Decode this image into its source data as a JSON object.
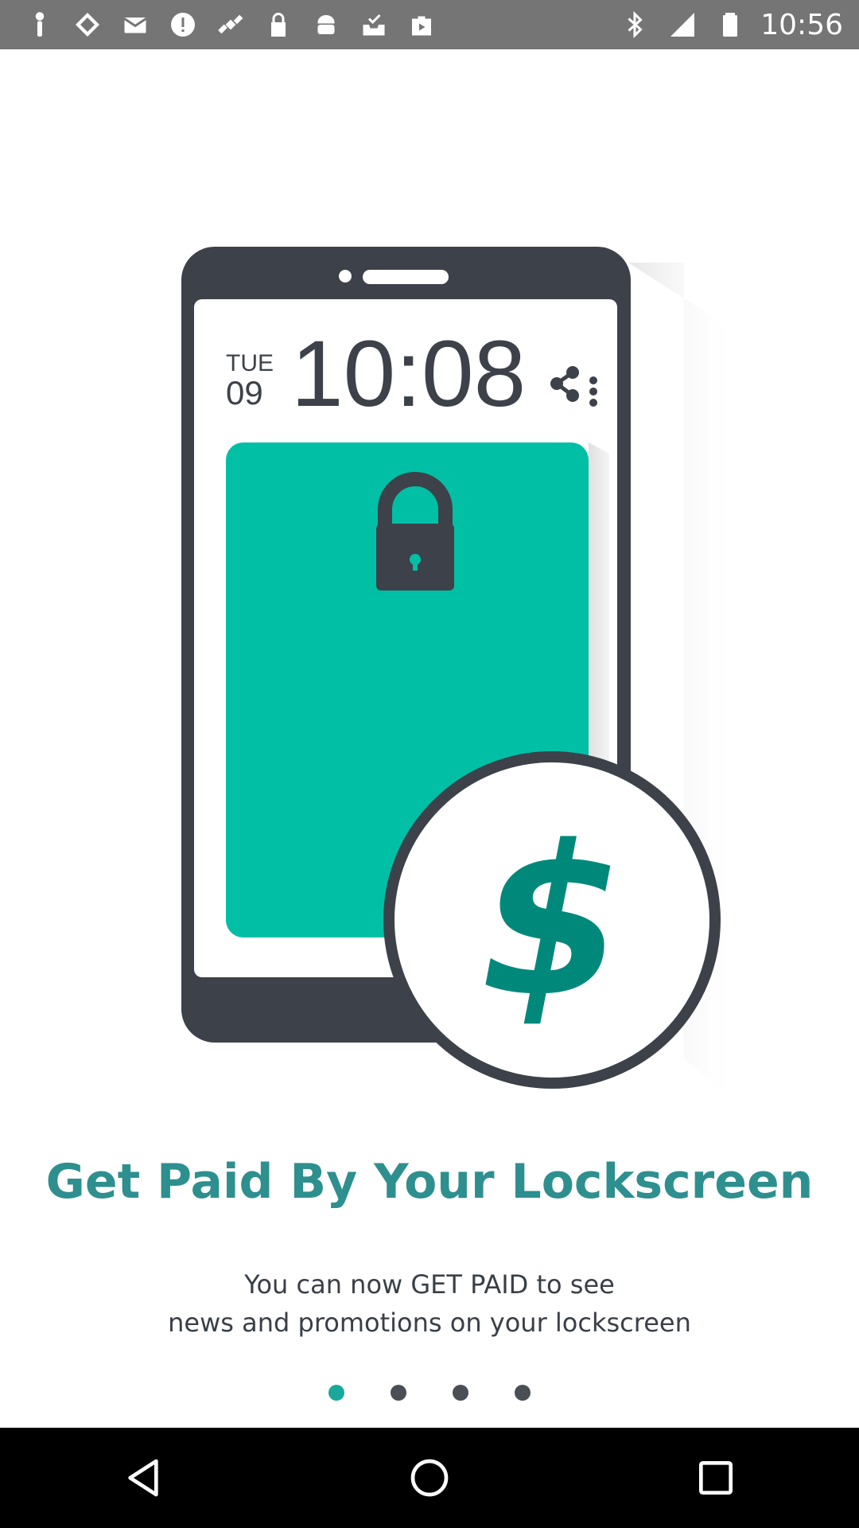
{
  "status_bar": {
    "time": "10:56",
    "left_icons": [
      "person-pin-icon",
      "navigation-diamond-icon",
      "mail-icon",
      "alert-circle-icon",
      "satellite-fake-gps-icon",
      "lock-icon",
      "android-icon",
      "inbox-check-icon",
      "play-store-icon"
    ],
    "right_icons": [
      "bluetooth-icon",
      "signal-icon",
      "battery-icon"
    ]
  },
  "illustration": {
    "lock_day": "TUE",
    "lock_date": "09",
    "lock_time": "10:08",
    "coin_symbol": "$",
    "colors": {
      "phone": "#3d4149",
      "screen_card": "#00bfa5",
      "dollar": "#00897b"
    }
  },
  "onboarding": {
    "title": "Get Paid By Your Lockscreen",
    "subtitle_line1": "You can now GET PAID to see",
    "subtitle_line2": "news and promotions on your lockscreen",
    "page_indicator": {
      "current": 1,
      "total": 4
    }
  },
  "nav_bar": {
    "buttons": [
      "back-icon",
      "home-icon",
      "recents-icon"
    ]
  },
  "colors": {
    "title": "#2e8f8f",
    "body_text": "#3a3f47",
    "dot_active": "#1aa89a",
    "dot_inactive": "#4a4e55"
  }
}
